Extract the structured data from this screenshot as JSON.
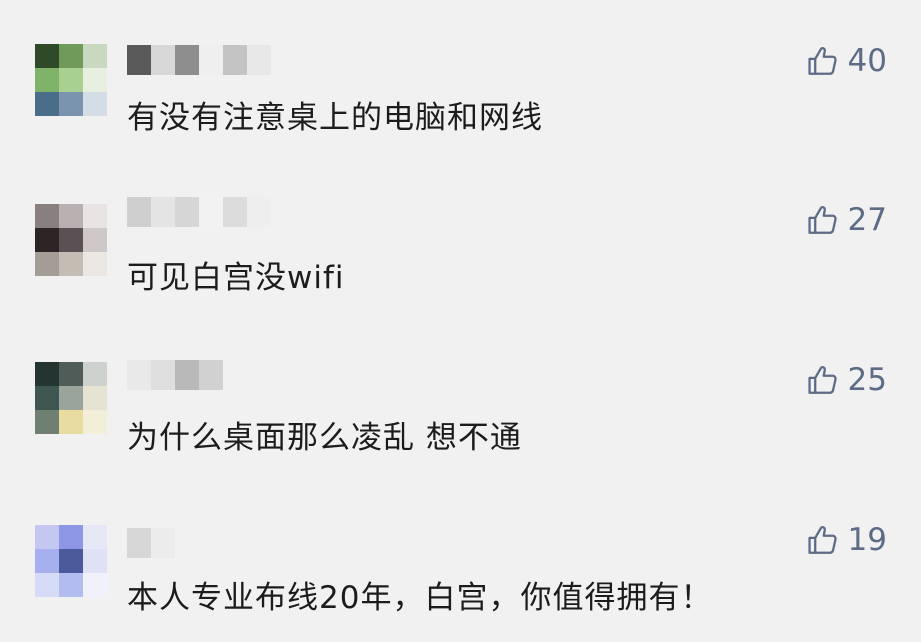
{
  "comments": [
    {
      "text": "有没有注意桌上的电脑和网线",
      "likes": "40",
      "avatar": [
        "#2e4a27",
        "#6f9a5a",
        "#c9d9c0",
        "#7fb36a",
        "#a8d090",
        "#e6efe0",
        "#4a6d8a",
        "#7b94ad",
        "#d4dde6"
      ],
      "name": [
        "#5a5a5a",
        "#d8d8d8",
        "#8e8e8e",
        "#efefef",
        "#c4c4c4",
        "#e8e8e8"
      ]
    },
    {
      "text": "可见白宫没wifi",
      "likes": "27",
      "avatar": [
        "#8a7f7f",
        "#b9b1b1",
        "#e8e4e4",
        "#2d2426",
        "#5b5154",
        "#cfc8c8",
        "#a39d95",
        "#c4bdb4",
        "#ebe8e4"
      ],
      "name": [
        "#cfcfcf",
        "#e4e4e4",
        "#d6d6d6",
        "#f2f2f2",
        "#dcdcdc",
        "#eeeeee"
      ]
    },
    {
      "text": "为什么桌面那么凌乱  想不通",
      "likes": "25",
      "avatar": [
        "#243430",
        "#4f5c58",
        "#cdd2cf",
        "#3f5552",
        "#9aa49a",
        "#e7e3d2",
        "#6f7f72",
        "#e8dca0",
        "#f3eed8"
      ],
      "name": [
        "#e9e9e9",
        "#dedede",
        "#b9b9b9",
        "#d1d1d1",
        "#f1f1f1",
        "#f1f1f1"
      ]
    },
    {
      "text": "本人专业布线20年，白宫，你值得拥有！",
      "likes": "19",
      "avatar": [
        "#c4c8f0",
        "#8e96e6",
        "#e6e8f8",
        "#a7b0ee",
        "#4b5a9a",
        "#dfe2f6",
        "#d6dbf7",
        "#b3bcef",
        "#f0f1fb"
      ],
      "name": [
        "#d7d7d7",
        "#ececec",
        "#f1f1f1",
        "#f1f1f1",
        "#f1f1f1",
        "#f1f1f1"
      ]
    }
  ],
  "icons": {
    "like": "thumbs-up-icon"
  },
  "colors": {
    "background": "#f1f1f1",
    "text": "#1c1c1c",
    "like": "#5d6b86"
  }
}
